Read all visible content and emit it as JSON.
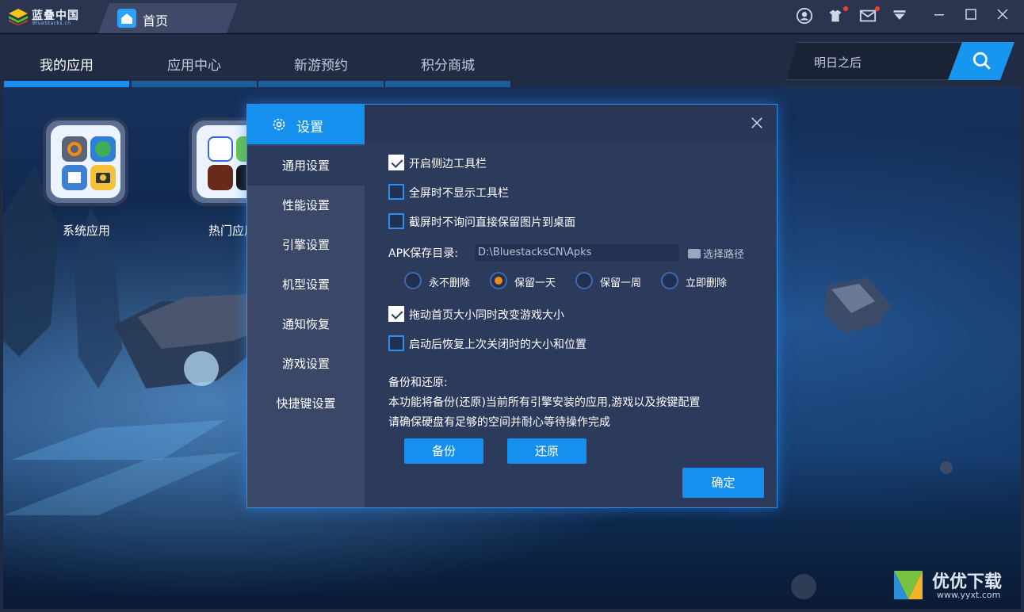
{
  "titlebar": {
    "logo_text": "蓝叠中国",
    "logo_sub": "BlueStacks.cn",
    "home_tab_label": "首页",
    "controls": [
      "user-icon",
      "tshirt-icon",
      "mail-icon",
      "download-icon",
      "minimize-icon",
      "maximize-icon",
      "close-icon"
    ]
  },
  "nav": {
    "tabs": [
      {
        "label": "我的应用",
        "active": true
      },
      {
        "label": "应用中心",
        "active": false
      },
      {
        "label": "新游预约",
        "active": false
      },
      {
        "label": "积分商城",
        "active": false
      }
    ],
    "search_text": "明日之后"
  },
  "apps": [
    {
      "label": "系统应用"
    },
    {
      "label": "热门应用"
    }
  ],
  "dialog": {
    "title": "设置",
    "sidebar": [
      {
        "label": "通用设置",
        "active": true
      },
      {
        "label": "性能设置",
        "active": false
      },
      {
        "label": "引擎设置",
        "active": false
      },
      {
        "label": "机型设置",
        "active": false
      },
      {
        "label": "通知恢复",
        "active": false
      },
      {
        "label": "游戏设置",
        "active": false
      },
      {
        "label": "快捷键设置",
        "active": false
      }
    ],
    "options": [
      {
        "label": "开启侧边工具栏",
        "checked": true
      },
      {
        "label": "全屏时不显示工具栏",
        "checked": false
      },
      {
        "label": "截屏时不询问直接保留图片到桌面",
        "checked": false
      }
    ],
    "apk_label": "APK保存目录:",
    "apk_path": "D:\\BluestacksCN\\Apks",
    "choose_path": "选择路径",
    "retention": [
      {
        "label": "永不删除",
        "checked": false
      },
      {
        "label": "保留一天",
        "checked": true
      },
      {
        "label": "保留一周",
        "checked": false
      },
      {
        "label": "立即删除",
        "checked": false
      }
    ],
    "options2": [
      {
        "label": "拖动首页大小同时改变游戏大小",
        "checked": true
      },
      {
        "label": "启动后恢复上次关闭时的大小和位置",
        "checked": false
      }
    ],
    "backup_title": "备份和还原:",
    "backup_desc": [
      "本功能将备份(还原)当前所有引擎安装的应用,游戏以及按键配置",
      "请确保硬盘有足够的空间并耐心等待操作完成"
    ],
    "backup_btn": "备份",
    "restore_btn": "还原",
    "ok_btn": "确定"
  },
  "watermark": {
    "text": "优优下载",
    "url": "www.yyxt.com"
  },
  "colors": {
    "accent": "#1590ee",
    "dialog_bg": "#2c3a5c",
    "sidebar_bg": "#3a4766",
    "radio_selected": "#f08a19"
  }
}
